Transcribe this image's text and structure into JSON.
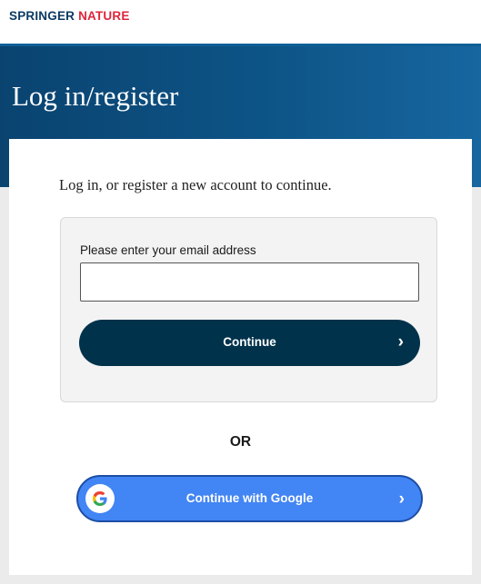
{
  "brand": {
    "part1": "SPRINGER",
    "part2": "NATURE"
  },
  "hero": {
    "title": "Log in/register"
  },
  "card": {
    "intro": "Log in, or register a new account to continue.",
    "email": {
      "label": "Please enter your email address",
      "value": "",
      "placeholder": ""
    },
    "continue_label": "Continue",
    "or_label": "OR",
    "google_label": "Continue with Google"
  },
  "icons": {
    "continue_chevron": "chevron-right-icon",
    "google_chevron": "chevron-right-icon",
    "google_logo": "google-g-icon"
  },
  "colors": {
    "brand_navy": "#0b3a63",
    "brand_red": "#e0243a",
    "hero_bg": "#0d5486",
    "continue_bg": "#01324b",
    "google_bg": "#4285f4"
  }
}
